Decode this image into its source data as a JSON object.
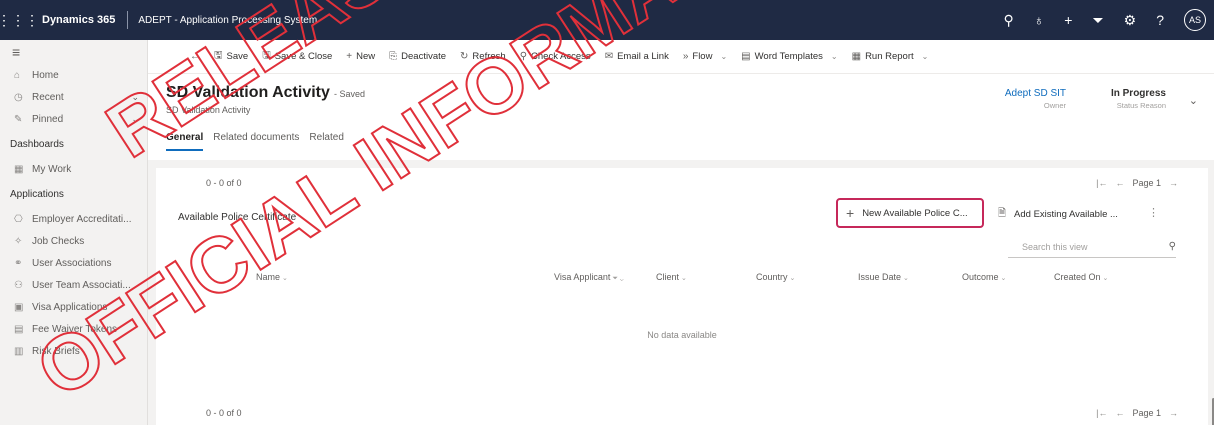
{
  "topbar": {
    "brand": "Dynamics 365",
    "app_name": "ADEPT - Application Processing System",
    "avatar_initials": "AS"
  },
  "sidebar": {
    "items_top": [
      {
        "icon": "home-icon",
        "glyph": "⌂",
        "label": "Home"
      },
      {
        "icon": "recent-icon",
        "glyph": "◷",
        "label": "Recent",
        "has_chevron": true
      },
      {
        "icon": "pin-icon",
        "glyph": "✎",
        "label": "Pinned",
        "has_chevron": true
      }
    ],
    "section_dashboards": "Dashboards",
    "dashboards": [
      {
        "icon": "dashboard-icon",
        "glyph": "▦",
        "label": "My Work"
      }
    ],
    "section_applications": "Applications",
    "applications": [
      {
        "icon": "accreditation-icon",
        "glyph": "⎔",
        "label": "Employer Accreditati..."
      },
      {
        "icon": "job-check-icon",
        "glyph": "✧",
        "label": "Job Checks"
      },
      {
        "icon": "user-association-icon",
        "glyph": "⚭",
        "label": "User Associations"
      },
      {
        "icon": "team-association-icon",
        "glyph": "⚇",
        "label": "User Team Associati..."
      },
      {
        "icon": "visa-application-icon",
        "glyph": "▣",
        "label": "Visa Applications"
      },
      {
        "icon": "fee-waiver-icon",
        "glyph": "▤",
        "label": "Fee Waiver Tokens"
      },
      {
        "icon": "risk-brief-icon",
        "glyph": "▥",
        "label": "Risk Briefs"
      }
    ]
  },
  "commandbar": {
    "save": "Save",
    "save_close": "Save & Close",
    "new": "New",
    "deactivate": "Deactivate",
    "refresh": "Refresh",
    "check_access": "Check Access",
    "email_link": "Email a Link",
    "flow": "Flow",
    "word_templates": "Word Templates",
    "run_report": "Run Report"
  },
  "header": {
    "title": "SD Validation Activity",
    "save_status": "- Saved",
    "entity": "SD Validation Activity",
    "owner_value": "Adept SD SIT",
    "owner_label": "Owner",
    "status_value": "In Progress",
    "status_label": "Status Reason"
  },
  "tabs": [
    "General",
    "Related documents",
    "Related"
  ],
  "subgrid": {
    "range_top": "0 - 0 of 0",
    "range_bottom": "0 - 0 of 0",
    "page_top": "Page 1",
    "page_bottom": "Page 1",
    "title": "Available Police Certificate",
    "new_button": "New Available Police C...",
    "add_existing_button": "Add Existing Available ...",
    "search_placeholder": "Search this view",
    "columns": [
      "Name",
      "Visa Applicant",
      "Client",
      "Country",
      "Issue Date",
      "Outcome",
      "Created On"
    ],
    "empty_message": "No data available"
  },
  "watermark": {
    "line1": "RELEASED UNDER",
    "line2": "OFFICIAL INFORMATION",
    "color": "#e0303a"
  }
}
